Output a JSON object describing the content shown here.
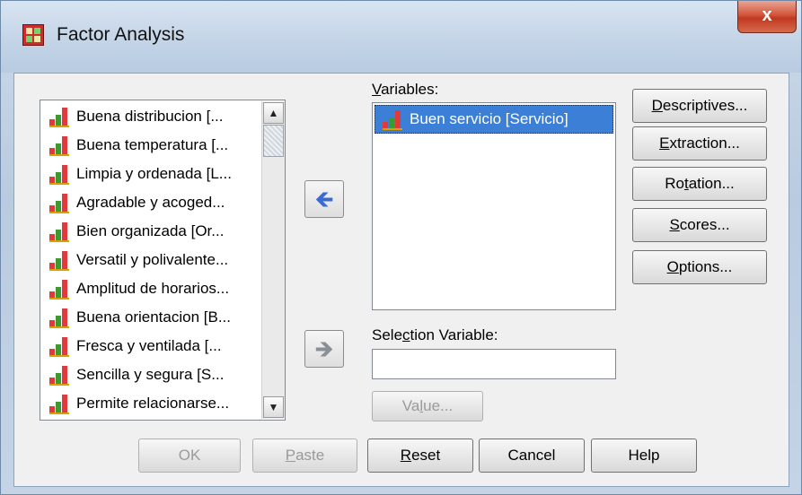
{
  "window": {
    "title": "Factor Analysis",
    "close_label": "x"
  },
  "source_list": {
    "items": [
      {
        "label": "Buena distribucion [..."
      },
      {
        "label": "Buena temperatura [..."
      },
      {
        "label": "Limpia y ordenada [L..."
      },
      {
        "label": "Agradable y acoged..."
      },
      {
        "label": "Bien organizada [Or..."
      },
      {
        "label": "Versatil y polivalente..."
      },
      {
        "label": "Amplitud de horarios..."
      },
      {
        "label": "Buena orientacion [B..."
      },
      {
        "label": "Fresca y ventilada [..."
      },
      {
        "label": "Sencilla y segura [S..."
      },
      {
        "label": "Permite relacionarse..."
      }
    ],
    "scroll_up": "▲",
    "scroll_down": "▼"
  },
  "variables": {
    "label_accel": "V",
    "label_rest": "ariables:",
    "items": [
      {
        "label": "Buen servicio [Servicio]"
      }
    ]
  },
  "move_buttons": {
    "variables_arrow": "🡸",
    "selection_arrow": "🡺"
  },
  "selection_variable": {
    "label_pre": "Sele",
    "label_accel": "c",
    "label_post": "tion Variable:",
    "value": ""
  },
  "value_button": {
    "pre": "Va",
    "accel": "l",
    "post": "ue..."
  },
  "side_buttons": {
    "descriptives": {
      "accel": "D",
      "rest": "escriptives..."
    },
    "extraction": {
      "accel": "E",
      "rest": "xtraction..."
    },
    "rotation": {
      "pre": "Ro",
      "accel": "t",
      "post": "ation..."
    },
    "scores": {
      "accel": "S",
      "rest": "cores..."
    },
    "options": {
      "accel": "O",
      "rest": "ptions..."
    }
  },
  "bottom_buttons": {
    "ok": "OK",
    "paste": {
      "accel": "P",
      "rest": "aste"
    },
    "reset": {
      "accel": "R",
      "rest": "eset"
    },
    "cancel": "Cancel",
    "help": "Help"
  },
  "colors": {
    "selection": "#3c7fd6",
    "close_button": "#c0391f",
    "arrow_active": "#3a6bd0"
  }
}
